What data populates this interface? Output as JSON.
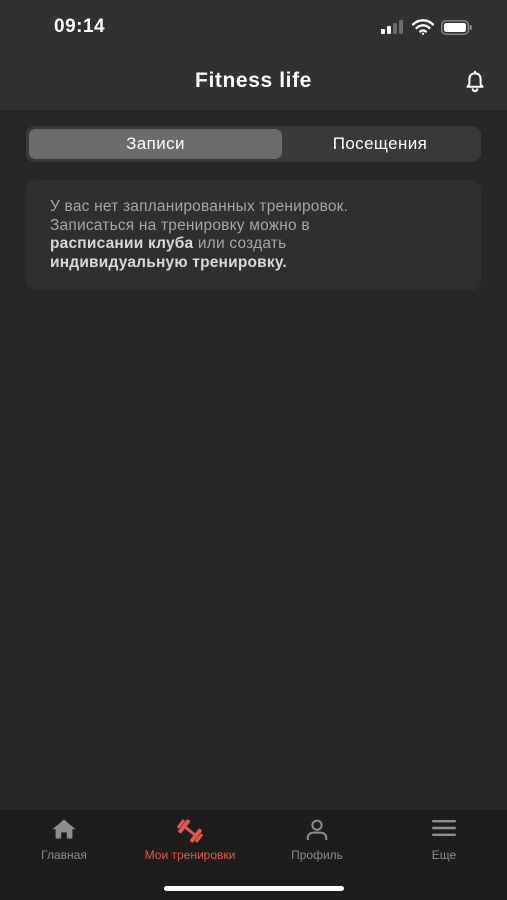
{
  "status": {
    "time": "09:14",
    "icons": [
      "cellular-signal-icon",
      "wifi-icon",
      "battery-icon"
    ]
  },
  "header": {
    "title": "Fitness life",
    "action_icon": "bell-icon"
  },
  "segments": {
    "items": [
      {
        "label": "Записи",
        "selected": true
      },
      {
        "label": "Посещения",
        "selected": false
      }
    ]
  },
  "empty_state": {
    "line1": "У вас нет запланированных тренировок.",
    "line2": "Записаться на тренировку можно в",
    "link1": "расписании клуба",
    "middle": " или создать",
    "link2": "индивидуальную тренировку."
  },
  "tabbar": {
    "items": [
      {
        "label": "Главная",
        "icon": "home-icon",
        "active": false
      },
      {
        "label": "Мои тренировки",
        "icon": "dumbbell-icon",
        "active": true
      },
      {
        "label": "Профиль",
        "icon": "profile-icon",
        "active": false
      },
      {
        "label": "Еще",
        "icon": "menu-icon",
        "active": false
      }
    ]
  },
  "colors": {
    "accent": "#e5574e",
    "background": "#272727",
    "header": "#313131",
    "tabbar": "#1d1d1d"
  }
}
